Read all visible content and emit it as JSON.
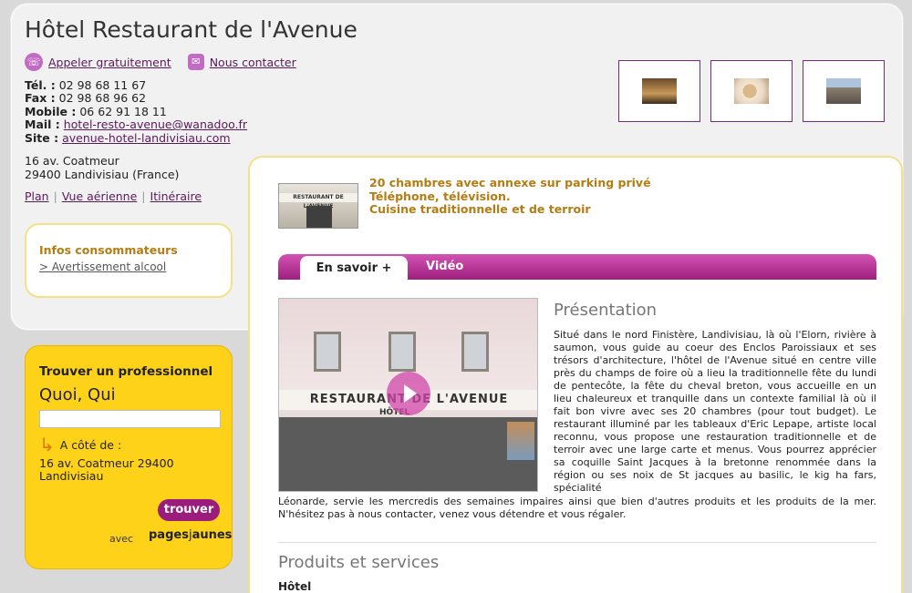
{
  "hotel": {
    "name": "Hôtel Restaurant de l'Avenue",
    "actions": {
      "call": "Appeler gratuitement",
      "contact": "Nous contacter"
    },
    "contact": {
      "tel_label": "Tél. :",
      "tel": "02 98 68 11 67",
      "fax_label": "Fax :",
      "fax": "02 98 68 96 62",
      "mobile_label": "Mobile :",
      "mobile": "06 62 91 18 11",
      "mail_label": "Mail :",
      "mail": "hotel-resto-avenue@wanadoo.fr",
      "site_label": "Site :",
      "site": "avenue-hotel-landivisiau.com"
    },
    "address": {
      "line1": "16 av. Coatmeur",
      "line2": "29400 Landivisiau (France)"
    },
    "links": [
      "Plan",
      "Vue aérienne",
      "Itinéraire"
    ]
  },
  "infos": {
    "heading": "Infos consommateurs",
    "link": "> Avertissement alcool"
  },
  "finder": {
    "heading": "Trouver un professionnel",
    "quoi": "Quoi, Qui",
    "acote": "A côté de :",
    "location_line1": "16 av. Coatmeur 29400",
    "location_line2": "Landivisiau",
    "button": "trouver",
    "avec": "avec",
    "brand": "pagesjaunes"
  },
  "main": {
    "thumb_sign": "RESTAURANT DE L'AVENUE",
    "features": [
      "20 chambres avec annexe sur parking privé",
      "Téléphone, télévision.",
      "Cuisine traditionnelle et de terroir"
    ],
    "tabs": [
      "En savoir +",
      "Vidéo"
    ],
    "video_sign": "RESTAURANT DE L'AVENUE",
    "video_sign2": "HÔTEL",
    "presentation_title": "Présentation",
    "presentation_text": "Situé dans le nord Finistère, Landivisiau, là où l'Elorn, rivière à saumon, vous guide au coeur des Enclos Paroissiaux et ses trésors d'architecture, l'hôtel de l'Avenue situé en centre ville près du champs de foire où a lieu la traditionnelle fête du lundi de pentecôte, la fête du cheval breton, vous accueille en un lieu chaleureux et tranquille dans un contexte familial là où il fait bon vivre avec ses 20 chambres (pour tout budget). Le restaurant illuminé par les tableaux d'Eric Lepape, artiste local reconnu, vous propose une restauration traditionnelle et de terroir avec une large carte et menus. Vous pourrez apprécier sa coquille Saint Jacques à la bretonne renommée dans la région ou ses noix de St jacques au basilic, le kig ha fars, spécialité",
    "presentation_text2": "Léonarde, servie les mercredis des semaines impaires ainsi que bien d'autres produits et les produits de la mer. N'hésitez pas à nous contacter, venez vous détendre et vous régaler.",
    "products_title": "Produits et services",
    "product_item": "Hôtel"
  }
}
